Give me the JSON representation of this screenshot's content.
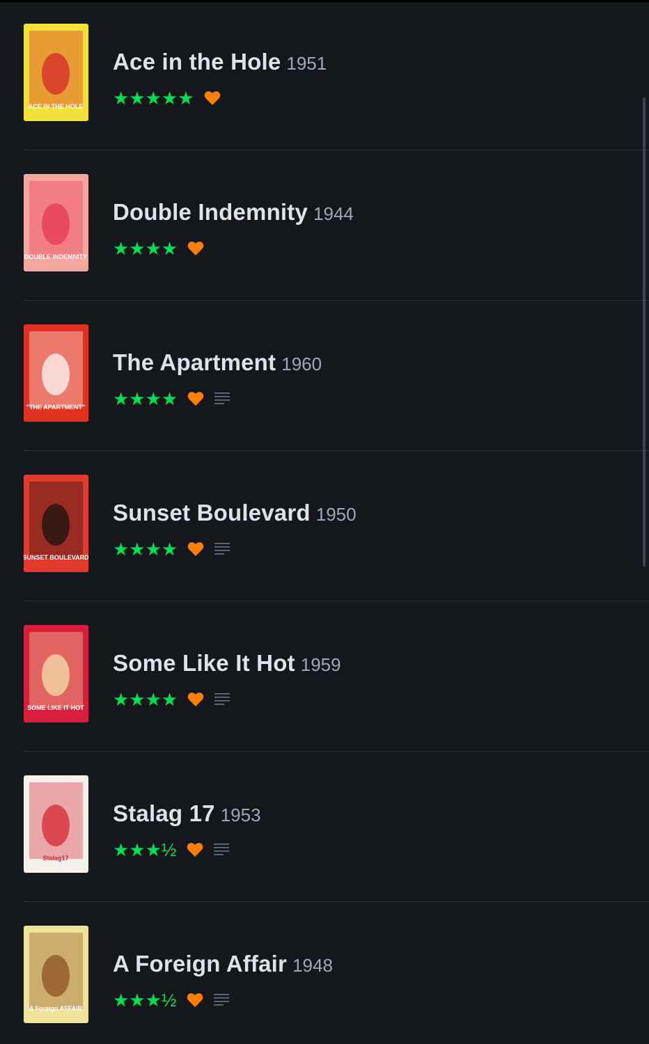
{
  "colors": {
    "background": "#14181c",
    "star": "#00e054",
    "heart": "#ff8000",
    "title": "#dce3ea",
    "year": "#99aabb",
    "divider": "#2c3440"
  },
  "films": [
    {
      "title": "Ace in the Hole",
      "year": "1951",
      "rating": 5,
      "stars_text": "★★★★★",
      "liked": true,
      "has_review": false,
      "poster": {
        "text": "ACE IN THE HOLE",
        "bg": "#f2e13a",
        "accent": "#d6202a"
      }
    },
    {
      "title": "Double Indemnity",
      "year": "1944",
      "rating": 4,
      "stars_text": "★★★★",
      "liked": true,
      "has_review": false,
      "poster": {
        "text": "DOUBLE INDEMNITY",
        "bg": "#f4a6a0",
        "accent": "#e8334f"
      }
    },
    {
      "title": "The Apartment",
      "year": "1960",
      "rating": 4,
      "stars_text": "★★★★",
      "liked": true,
      "has_review": true,
      "poster": {
        "text": "\"THE APARTMENT\"",
        "bg": "#e0331f",
        "accent": "#ffffff"
      }
    },
    {
      "title": "Sunset Boulevard",
      "year": "1950",
      "rating": 4,
      "stars_text": "★★★★",
      "liked": true,
      "has_review": true,
      "poster": {
        "text": "SUNSET BOULEVARD",
        "bg": "#e23a2c",
        "accent": "#111111"
      }
    },
    {
      "title": "Some Like It Hot",
      "year": "1959",
      "rating": 4,
      "stars_text": "★★★★",
      "liked": true,
      "has_review": true,
      "poster": {
        "text": "SOME LIKE IT HOT",
        "bg": "#d81e3a",
        "accent": "#f6e7b0"
      }
    },
    {
      "title": "Stalag 17",
      "year": "1953",
      "rating": 3.5,
      "stars_text": "★★★½",
      "liked": true,
      "has_review": true,
      "poster": {
        "text": "Stalag17",
        "bg": "#f3f1ea",
        "accent": "#d6202a"
      }
    },
    {
      "title": "A Foreign Affair",
      "year": "1948",
      "rating": 3.5,
      "stars_text": "★★★½",
      "liked": true,
      "has_review": true,
      "poster": {
        "text": "A Foreign AFFAIR",
        "bg": "#efe29a",
        "accent": "#8a4a1c"
      }
    }
  ]
}
